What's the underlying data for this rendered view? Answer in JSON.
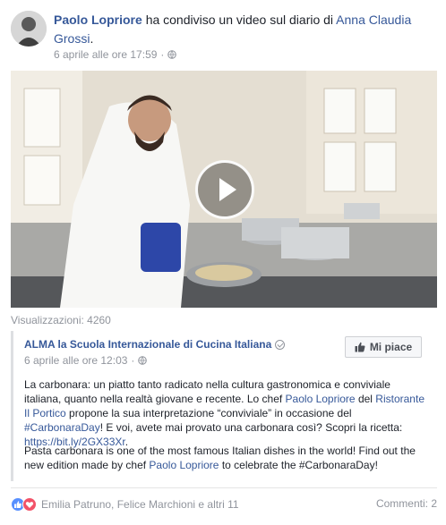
{
  "post": {
    "author": "Paolo Lopriore",
    "action": "ha condiviso un video sul diario di",
    "target": "Anna Claudia Grossi",
    "target_suffix": ".",
    "timestamp": "6 aprile alle ore 17:59",
    "separator": "·"
  },
  "video": {
    "views_label": "Visualizzazioni: 4260"
  },
  "shared": {
    "page_name": "ALMA la Scuola Internazionale di Cucina Italiana",
    "timestamp": "6 aprile alle ore 12:03",
    "separator": "·",
    "like_button": "Mi piace",
    "p1_a": "La carbonara: un piatto tanto radicato nella cultura gastronomica e conviviale italiana, quanto nella realtà giovane e recente. Lo chef ",
    "p1_link1": "Paolo Lopriore",
    "p1_b": " del ",
    "p1_link2": "Ristorante Il Portico",
    "p1_c": " propone la sua interpretazione “conviviale” in occasione del ",
    "p1_hashtag": "#CarbonaraDay",
    "p1_d": "! E voi, avete mai provato una carbonara così? Scopri la ricetta: ",
    "p1_url": "https://bit.ly/2GX33Xr",
    "p1_e": ".",
    "p2_a": "Pasta carbonara is one of the most famous Italian dishes in the world! Find out the new edition made by chef ",
    "p2_link": "Paolo Lopriore",
    "p2_b": " to celebrate the #CarbonaraDay!"
  },
  "footer": {
    "reactions_names": "Emilia Patruno, Felice Marchioni e altri 11",
    "comments": "Commenti: 2"
  },
  "colors": {
    "link": "#365899",
    "meta": "#90949c",
    "text": "#1d2129",
    "like_reaction": "#5890ff",
    "love_reaction": "#f25268"
  },
  "icons": [
    "globe-icon",
    "play-icon",
    "verified-icon",
    "thumbs-up-icon",
    "like-reaction-icon",
    "love-reaction-icon"
  ]
}
